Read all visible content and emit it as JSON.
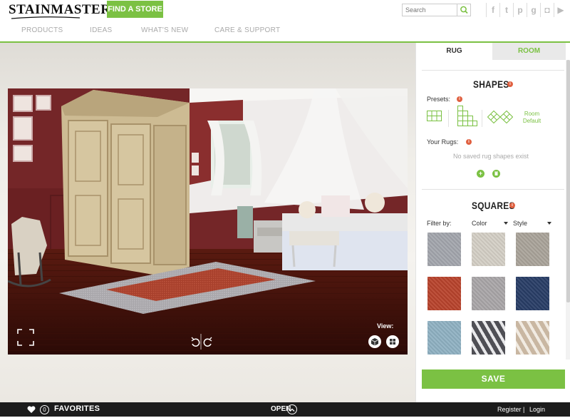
{
  "header": {
    "logo": "STAINMASTER",
    "find_store": "FIND A STORE",
    "search_placeholder": "Search",
    "social_icons": [
      "facebook-icon",
      "twitter-icon",
      "pinterest-icon",
      "google-plus-icon",
      "instagram-icon",
      "youtube-icon"
    ]
  },
  "nav": {
    "items": [
      "PRODUCTS",
      "IDEAS",
      "WHAT'S NEW",
      "CARE & SUPPORT"
    ]
  },
  "viewer": {
    "view_label": "View:"
  },
  "panel": {
    "tabs": [
      "RUG",
      "ROOM"
    ],
    "shapes": {
      "title": "SHAPES",
      "presets_label": "Presets:",
      "room_default": [
        "Room",
        "Default"
      ],
      "your_rugs_label": "Your Rugs:",
      "empty_message": "No saved rug shapes exist"
    },
    "squares": {
      "title": "SQUARES",
      "filter_label": "Filter by:",
      "filters": [
        "Color",
        "Style"
      ],
      "swatch_colors": [
        "#a3a6ad",
        "#d4cfc6",
        "#aaa49a",
        "#b8432c",
        "#a9a6a8",
        "#283d66",
        "#8fb1c2",
        "#4f4f55",
        "#c9b7a2"
      ]
    },
    "save": "SAVE"
  },
  "footer": {
    "favorites_count": "0",
    "favorites": "FAVORITES",
    "open": "OPEN",
    "register": "Register",
    "separator": "|",
    "login": "Login"
  },
  "colors": {
    "accent": "#7bc143",
    "info": "#e06040"
  }
}
